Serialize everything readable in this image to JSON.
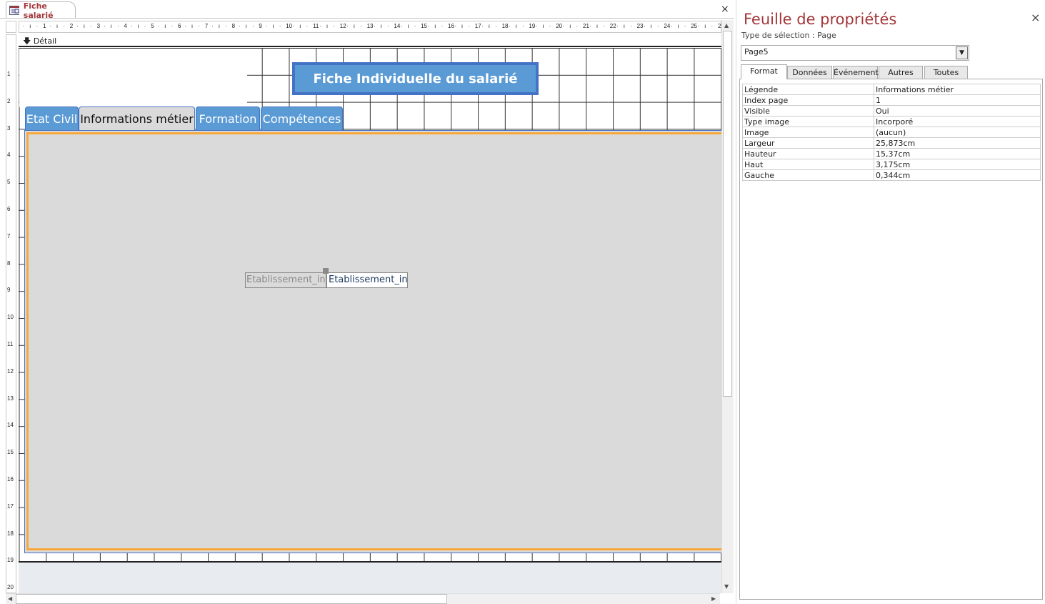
{
  "document": {
    "tab_title": "Fiche salarié",
    "close": "×"
  },
  "ruler": {
    "horizontal": [
      "1",
      "2",
      "3",
      "4",
      "5",
      "6",
      "7",
      "8",
      "9",
      "10",
      "11",
      "12",
      "13",
      "14",
      "15",
      "16",
      "17",
      "18",
      "19",
      "20",
      "21",
      "22",
      "23",
      "24",
      "25",
      "2"
    ],
    "vertical": [
      "1",
      "2",
      "3",
      "4",
      "5",
      "6",
      "7",
      "8",
      "9",
      "10",
      "11",
      "12",
      "13",
      "14",
      "15",
      "16",
      "17",
      "18",
      "19",
      "20"
    ]
  },
  "section": {
    "label": "Détail"
  },
  "form": {
    "title_button": "Fiche Individuelle du salarié",
    "tabs": [
      {
        "label": "Etat Civil"
      },
      {
        "label": "Informations métier",
        "selected": true
      },
      {
        "label": "Formation"
      },
      {
        "label": "Compétences"
      }
    ],
    "field_label": "Etablissement_inf",
    "field_textbox": "Etablissement_inf"
  },
  "colors": {
    "tab_blue": "#5b9bd5",
    "selection_orange": "#f7a83d",
    "title_red": "#a4373a"
  },
  "property_sheet": {
    "title": "Feuille de propriétés",
    "close": "×",
    "selection_type": "Type de sélection :  Page",
    "selected_object": "Page5",
    "tabs": [
      {
        "label": "Format",
        "selected": true
      },
      {
        "label": "Données"
      },
      {
        "label": "Événement"
      },
      {
        "label": "Autres"
      },
      {
        "label": "Toutes"
      }
    ],
    "properties": [
      {
        "name": "Légende",
        "value": "Informations métier"
      },
      {
        "name": "Index page",
        "value": "1"
      },
      {
        "name": "Visible",
        "value": "Oui"
      },
      {
        "name": "Type image",
        "value": "Incorporé"
      },
      {
        "name": "Image",
        "value": "(aucun)"
      },
      {
        "name": "Largeur",
        "value": "25,873cm"
      },
      {
        "name": "Hauteur",
        "value": "15,37cm"
      },
      {
        "name": "Haut",
        "value": "3,175cm"
      },
      {
        "name": "Gauche",
        "value": "0,344cm"
      }
    ]
  }
}
